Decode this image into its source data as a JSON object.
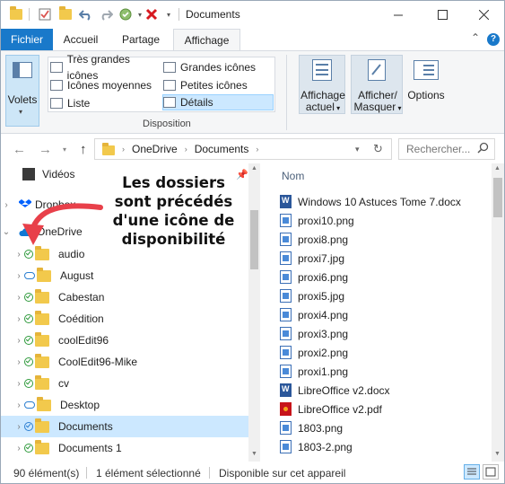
{
  "window": {
    "title": "Documents"
  },
  "tabs": {
    "file": "Fichier",
    "home": "Accueil",
    "share": "Partage",
    "view": "Affichage"
  },
  "ribbon": {
    "panes": "Volets",
    "layouts": {
      "xl_icons": "Très grandes icônes",
      "large_icons": "Grandes icônes",
      "medium_icons": "Icônes moyennes",
      "small_icons": "Petites icônes",
      "list": "Liste",
      "details": "Détails"
    },
    "group_layout": "Disposition",
    "current_view": "Affichage",
    "current_view2": "actuel",
    "show_hide": "Afficher/",
    "show_hide2": "Masquer",
    "options": "Options"
  },
  "address": {
    "crumbs": [
      "OneDrive",
      "Documents"
    ],
    "search_placeholder": "Rechercher..."
  },
  "nav": {
    "items": [
      {
        "label": "Vidéos",
        "type": "video"
      },
      {
        "label": "Dropbox",
        "type": "dropbox"
      },
      {
        "label": "OneDrive",
        "type": "onedrive"
      },
      {
        "label": "audio",
        "status": "ok"
      },
      {
        "label": "August",
        "status": "cloud"
      },
      {
        "label": "Cabestan",
        "status": "ok"
      },
      {
        "label": "Coédition",
        "status": "ok"
      },
      {
        "label": "coolEdit96",
        "status": "ok"
      },
      {
        "label": "CoolEdit96-Mike",
        "status": "ok"
      },
      {
        "label": "cv",
        "status": "ok"
      },
      {
        "label": "Desktop",
        "status": "cloud"
      },
      {
        "label": "Documents",
        "status": "sync",
        "selected": true
      },
      {
        "label": "Documents 1",
        "status": "ok"
      }
    ]
  },
  "callout": {
    "line1": "Les dossiers",
    "line2": "sont précédés",
    "line3": "d'une icône de",
    "line4": "disponibilité"
  },
  "list": {
    "column_name": "Nom",
    "files": [
      {
        "name": "Windows 10 Astuces Tome 7.docx",
        "type": "docx"
      },
      {
        "name": "proxi10.png",
        "type": "png"
      },
      {
        "name": "proxi8.png",
        "type": "png"
      },
      {
        "name": "proxi7.jpg",
        "type": "png"
      },
      {
        "name": "proxi6.png",
        "type": "png"
      },
      {
        "name": "proxi5.jpg",
        "type": "png"
      },
      {
        "name": "proxi4.png",
        "type": "png"
      },
      {
        "name": "proxi3.png",
        "type": "png"
      },
      {
        "name": "proxi2.png",
        "type": "png"
      },
      {
        "name": "proxi1.png",
        "type": "png"
      },
      {
        "name": "LibreOffice v2.docx",
        "type": "docx"
      },
      {
        "name": "LibreOffice v2.pdf",
        "type": "pdf"
      },
      {
        "name": "1803.png",
        "type": "png"
      },
      {
        "name": "1803-2.png",
        "type": "png"
      }
    ]
  },
  "statusbar": {
    "count": "90 élément(s)",
    "selection": "1 élément sélectionné",
    "availability": "Disponible sur cet appareil"
  },
  "colors": {
    "accent": "#1979ca",
    "selection": "#cce8ff",
    "callout_arrow": "#e8404a"
  }
}
